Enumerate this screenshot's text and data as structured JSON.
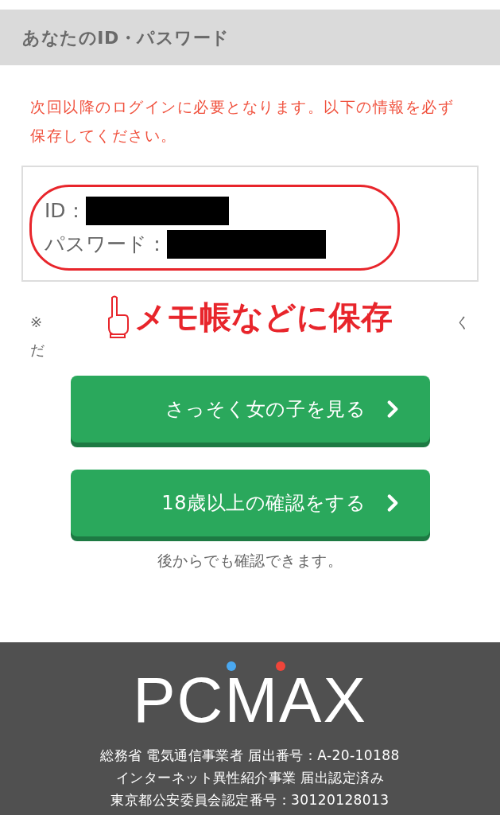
{
  "section_header": {
    "title": "あなたのID・パスワード"
  },
  "notice": "次回以降のログインに必要となります。以下の情報を必ず保存してください。",
  "credentials": [
    {
      "label": "ID："
    },
    {
      "label": "パスワード："
    }
  ],
  "note_fragments": {
    "line_1_start": "※",
    "line_1_end": "く",
    "line_2_start": "だ"
  },
  "callout": {
    "text": "メモ帳などに保存"
  },
  "buttons": [
    {
      "label": "さっそく女の子を見る"
    },
    {
      "label": "18歳以上の確認をする"
    }
  ],
  "caption": "後からでも確認できます。",
  "footer": {
    "logo": "PCMAX",
    "lines": [
      "総務省 電気通信事業者 届出番号：A-20-10188",
      "インターネット異性紹介事業 届出認定済み",
      "東京都公安委員会認定番号：30120128013"
    ]
  }
}
